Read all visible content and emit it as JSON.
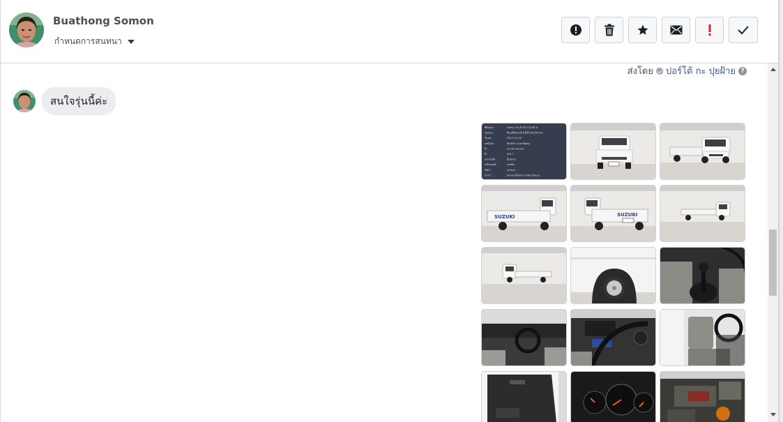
{
  "header": {
    "user_name": "Buathong Somon",
    "conversation_menu_label": "กำหนดการสนทนา",
    "actions": [
      {
        "name": "mark-spam",
        "icon": "exclamation-circle-icon"
      },
      {
        "name": "delete",
        "icon": "trash-icon"
      },
      {
        "name": "star",
        "icon": "star-icon"
      },
      {
        "name": "mark-unread",
        "icon": "envelope-icon"
      },
      {
        "name": "important",
        "icon": "exclamation-icon",
        "color": "#e02020"
      },
      {
        "name": "done",
        "icon": "check-icon"
      }
    ]
  },
  "thread": {
    "sent_by_prefix": "ส่งโดย",
    "sent_by_name": "ปอร์โต้ กะ ปุยฝ้าย",
    "help_label": "?",
    "message_text": "สนใจรุ่นนี้ค่ะ"
  },
  "images": [
    {
      "kind": "spec-sheet"
    },
    {
      "kind": "truck-front"
    },
    {
      "kind": "truck-front-right"
    },
    {
      "kind": "truck-rear-left"
    },
    {
      "kind": "truck-rear"
    },
    {
      "kind": "truck-side-right"
    },
    {
      "kind": "truck-side-left"
    },
    {
      "kind": "wheel-closeup"
    },
    {
      "kind": "gear-shift"
    },
    {
      "kind": "dashboard"
    },
    {
      "kind": "dashboard-steering"
    },
    {
      "kind": "seats"
    },
    {
      "kind": "door-panel"
    },
    {
      "kind": "gauges"
    },
    {
      "kind": "engine"
    }
  ],
  "spec_sheet": {
    "rows": [
      [
        "ยี่ห้อ/รุ่น :",
        "Carry 1.6 (ปี 05-15) MT 4"
      ],
      [
        "รุ่นย่อย :",
        "ทีเอสชีทตามปี ครั้งที่ 30,000 km"
      ],
      [
        "วันจด :",
        "2017-11-14"
      ],
      [
        "เลขไมล์ :",
        "68,674 (ราคาพิเศษ)"
      ],
      [
        "สี :",
        "ขาว/ขาวสะอาด"
      ],
      [
        "ปี :",
        "2017"
      ],
      [
        "ประกันภัย :",
        "คุ้มครอง"
      ],
      [
        "เครื่องยนต์ :",
        "เบนซิน"
      ],
      [
        "เกียร์ :",
        "ธรรมดา"
      ],
      [
        "สาขา :",
        "ตลาดรถมือสอง ภาคตะวันออก"
      ]
    ]
  },
  "colors": {
    "accent_link": "#365899",
    "bubble_bg": "#ebedf0",
    "spec_bg": "#363d4f"
  }
}
